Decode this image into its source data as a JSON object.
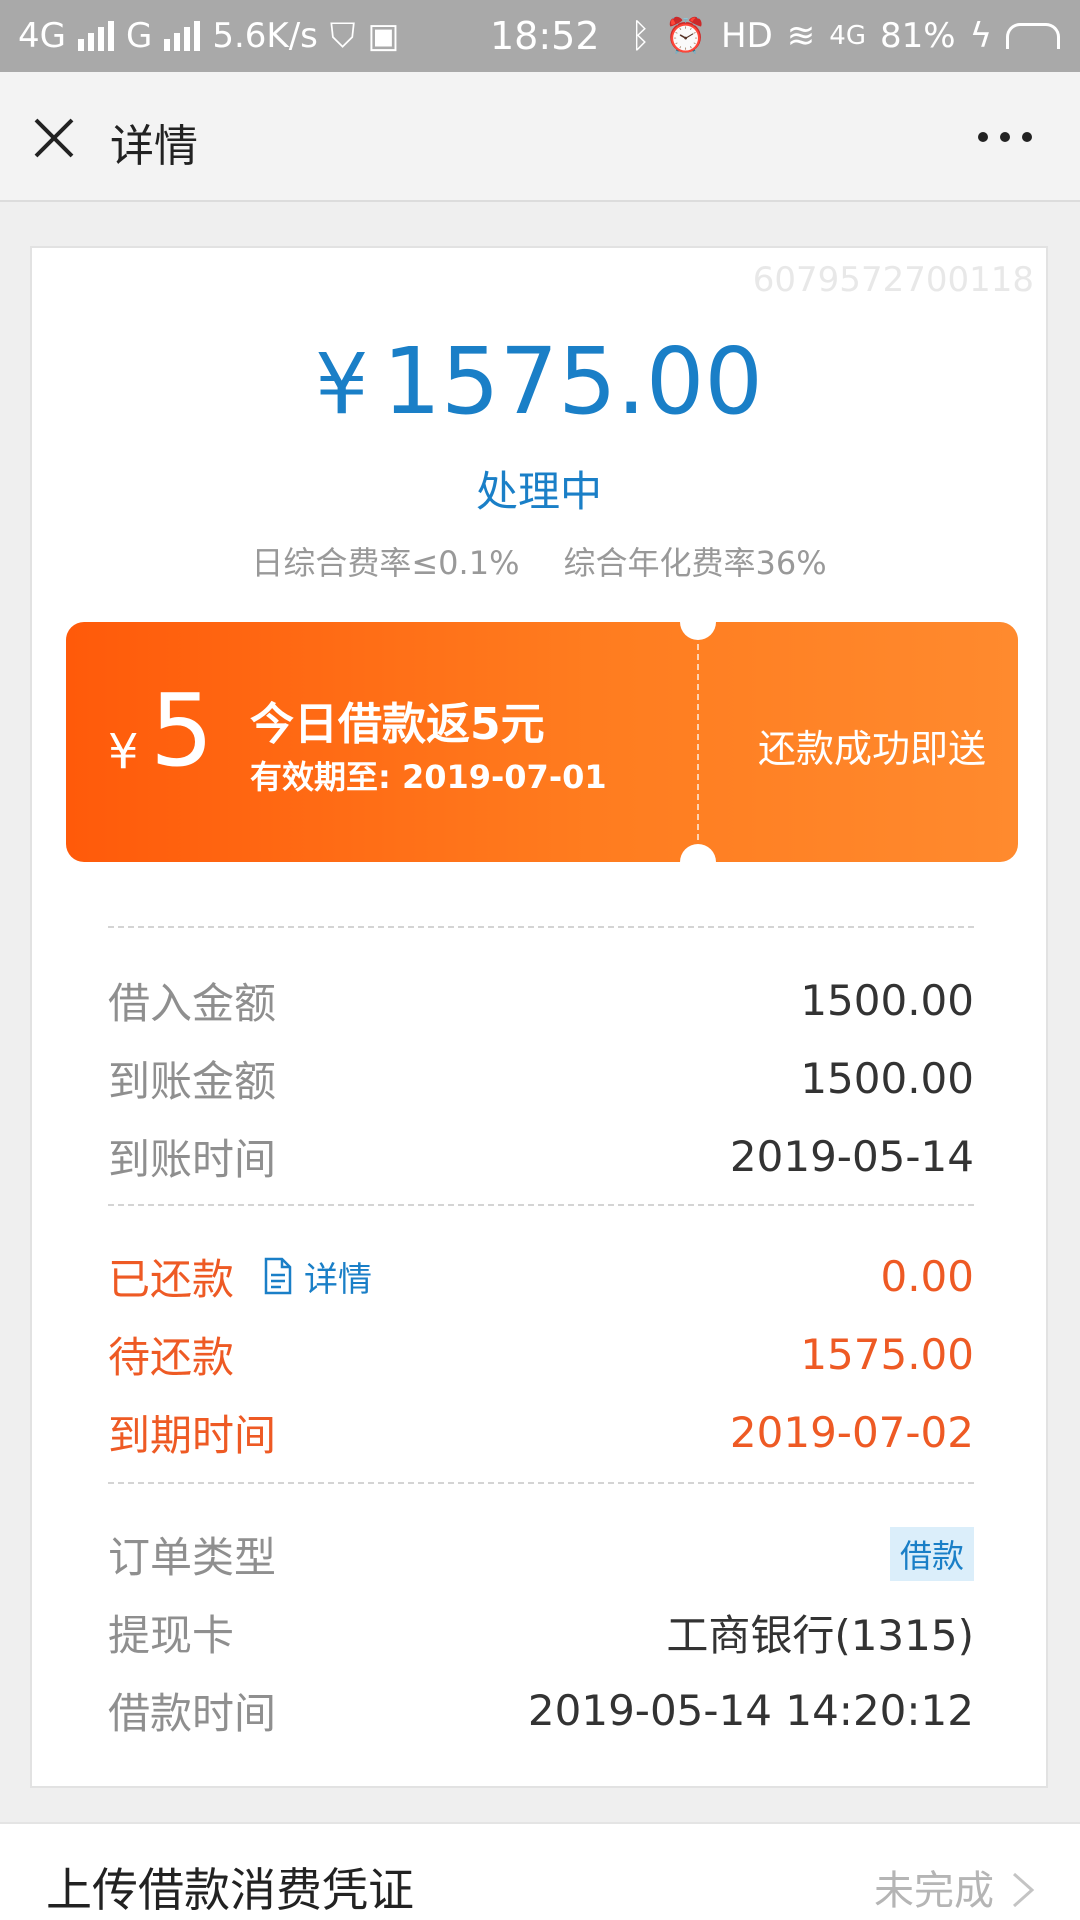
{
  "statusbar": {
    "network1": "4G",
    "network2": "G",
    "speed": "5.6K/s",
    "time": "18:52",
    "hd": "HD",
    "net4g": "4G",
    "battery": "81%"
  },
  "header": {
    "title": "详情"
  },
  "card": {
    "order_id": "6079572700118",
    "currency": "¥",
    "amount": "1575.00",
    "status": "处理中",
    "rate_daily": "日综合费率≤0.1%",
    "rate_annual": "综合年化费率36%"
  },
  "coupon": {
    "currency": "¥",
    "value": "5",
    "title": "今日借款返5元",
    "validity": "有效期至: 2019-07-01",
    "right_text": "还款成功即送"
  },
  "loan": {
    "borrowed_label": "借入金额",
    "borrowed_value": "1500.00",
    "received_label": "到账金额",
    "received_value": "1500.00",
    "received_time_label": "到账时间",
    "received_time_value": "2019-05-14"
  },
  "repay": {
    "repaid_label": "已还款",
    "detail_link": "详情",
    "repaid_value": "0.00",
    "pending_label": "待还款",
    "pending_value": "1575.00",
    "due_label": "到期时间",
    "due_value": "2019-07-02"
  },
  "order": {
    "type_label": "订单类型",
    "type_value": "借款",
    "card_label": "提现卡",
    "card_value": "工商银行(1315)",
    "time_label": "借款时间",
    "time_value": "2019-05-14 14:20:12"
  },
  "bottom": {
    "title": "上传借款消费凭证",
    "status": "未完成"
  },
  "colors": {
    "accent_blue": "#1a7fc7",
    "accent_red": "#ee5a24",
    "coupon_start": "#ff5a0a",
    "coupon_end": "#ff8a2e"
  }
}
